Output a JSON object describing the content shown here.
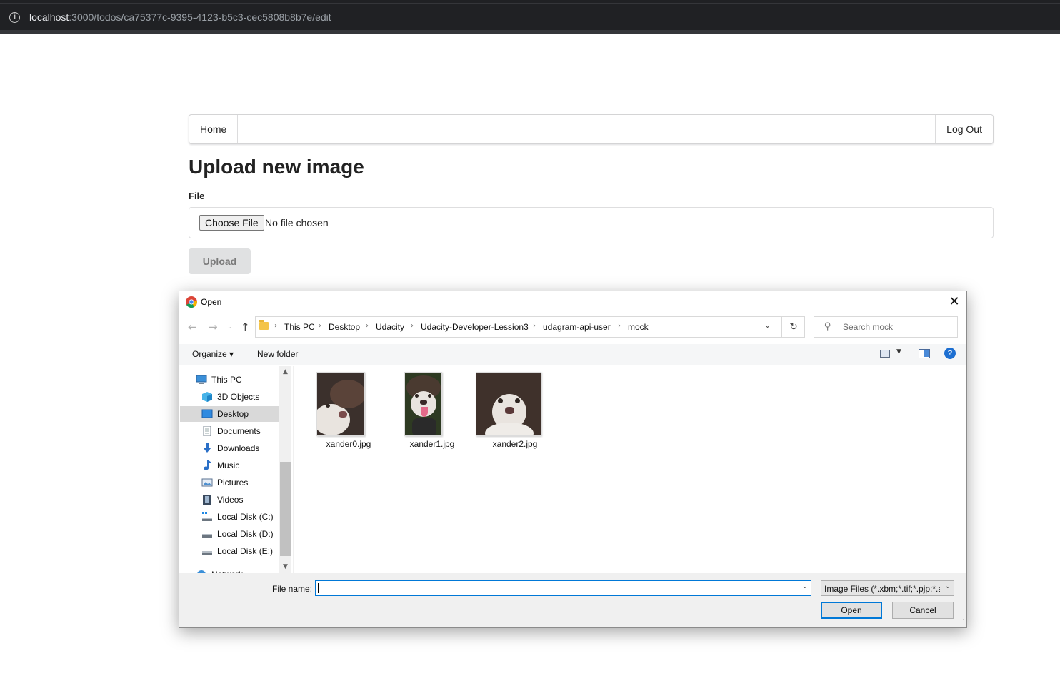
{
  "browser": {
    "url_host": "localhost",
    "url_rest": ":3000/todos/ca75377c-9395-4123-b5c3-cec5808b8b7e/edit"
  },
  "nav": {
    "home": "Home",
    "logout": "Log Out"
  },
  "page": {
    "title": "Upload new image",
    "file_label": "File",
    "choose_file": "Choose File",
    "no_file": "No file chosen",
    "upload": "Upload"
  },
  "dialog": {
    "title": "Open",
    "close": "✕",
    "breadcrumbs": [
      "This PC",
      "Desktop",
      "Udacity",
      "Udacity-Developer-Lession3",
      "udagram-api-user",
      "mock"
    ],
    "search_placeholder": "Search mock",
    "organize": "Organize ▾",
    "new_folder": "New folder",
    "sidebar": [
      {
        "label": "This PC",
        "icon": "computer-icon",
        "selected": false
      },
      {
        "label": "3D Objects",
        "icon": "cube-icon",
        "selected": false
      },
      {
        "label": "Desktop",
        "icon": "desktop-icon",
        "selected": true
      },
      {
        "label": "Documents",
        "icon": "document-icon",
        "selected": false
      },
      {
        "label": "Downloads",
        "icon": "download-icon",
        "selected": false
      },
      {
        "label": "Music",
        "icon": "music-icon",
        "selected": false
      },
      {
        "label": "Pictures",
        "icon": "pictures-icon",
        "selected": false
      },
      {
        "label": "Videos",
        "icon": "video-icon",
        "selected": false
      },
      {
        "label": "Local Disk (C:)",
        "icon": "disk-icon",
        "selected": false
      },
      {
        "label": "Local Disk (D:)",
        "icon": "disk-icon",
        "selected": false
      },
      {
        "label": "Local Disk (E:)",
        "icon": "disk-icon",
        "selected": false
      },
      {
        "label": "Network",
        "icon": "network-icon",
        "selected": false
      }
    ],
    "files": [
      {
        "name": "xander0.jpg"
      },
      {
        "name": "xander1.jpg"
      },
      {
        "name": "xander2.jpg"
      }
    ],
    "file_name_label": "File name:",
    "file_name_value": "",
    "file_type": "Image Files (*.xbm;*.tif;*.pjp;*.a",
    "open_button": "Open",
    "cancel_button": "Cancel"
  }
}
